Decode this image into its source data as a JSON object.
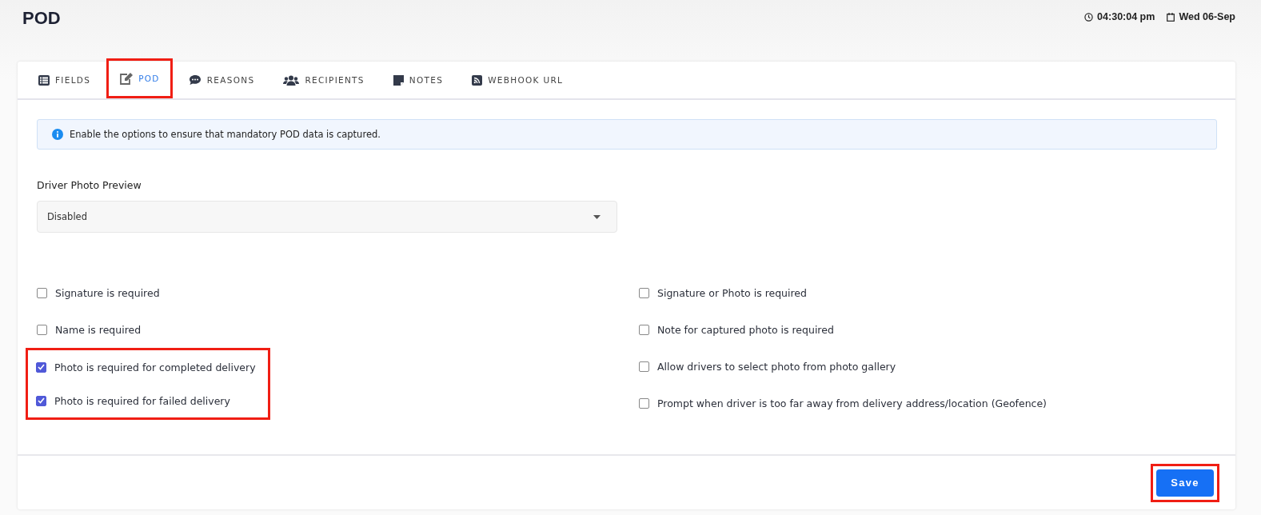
{
  "page": {
    "title": "POD",
    "time": "04:30:04 pm",
    "date": "Wed 06-Sep"
  },
  "tabs": [
    {
      "label": "FIELDS",
      "kind": "list",
      "selected": false,
      "highlighted": false
    },
    {
      "label": "POD",
      "kind": "edit",
      "selected": true,
      "highlighted": true
    },
    {
      "label": "REASONS",
      "kind": "chat",
      "selected": false,
      "highlighted": false
    },
    {
      "label": "RECIPIENTS",
      "kind": "users",
      "selected": false,
      "highlighted": false
    },
    {
      "label": "NOTES",
      "kind": "note",
      "selected": false,
      "highlighted": false
    },
    {
      "label": "WEBHOOK URL",
      "kind": "rss",
      "selected": false,
      "highlighted": false
    }
  ],
  "info": "Enable the options to ensure that mandatory POD data is captured.",
  "driver_photo_preview": {
    "label": "Driver Photo Preview",
    "value": "Disabled"
  },
  "left_options": [
    {
      "highlighted": false,
      "items": [
        {
          "label": "Signature is required",
          "checked": false
        },
        {
          "label": "Name is required",
          "checked": false
        }
      ]
    },
    {
      "highlighted": true,
      "items": [
        {
          "label": "Photo is required for completed delivery",
          "checked": true
        },
        {
          "label": "Photo is required for failed delivery",
          "checked": true
        }
      ]
    }
  ],
  "right_options": [
    {
      "label": "Signature or Photo is required",
      "checked": false
    },
    {
      "label": "Note for captured photo is required",
      "checked": false
    },
    {
      "label": "Allow drivers to select photo from photo gallery",
      "checked": false
    },
    {
      "label": "Prompt when driver is too far away from delivery address/location (Geofence)",
      "checked": false
    }
  ],
  "save_button": {
    "label": "Save",
    "highlighted": true
  }
}
